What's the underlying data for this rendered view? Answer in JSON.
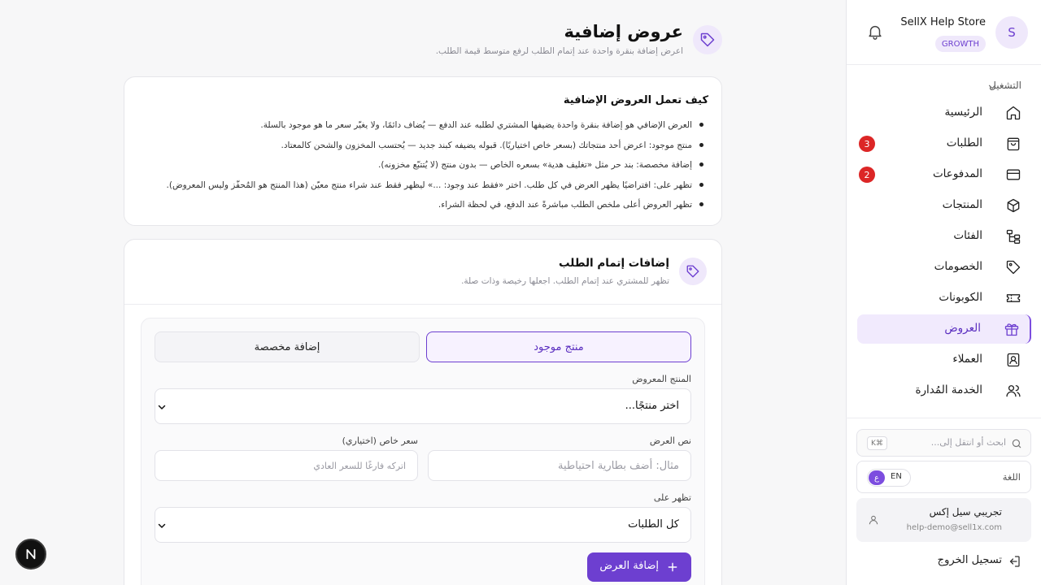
{
  "sidebar": {
    "store": {
      "avatar_letter": "S",
      "name": "SellX Help Store",
      "plan": "GROWTH"
    },
    "section_label": "التشغيل",
    "items": [
      {
        "label": "الرئيسية",
        "icon": "home-icon"
      },
      {
        "label": "الطلبات",
        "icon": "bag-icon",
        "count": "3"
      },
      {
        "label": "المدفوعات",
        "icon": "card-icon",
        "count": "2"
      },
      {
        "label": "المنتجات",
        "icon": "box-icon"
      },
      {
        "label": "الفئات",
        "icon": "category-tree-icon"
      },
      {
        "label": "الخصومات",
        "icon": "tag-icon"
      },
      {
        "label": "الكوبونات",
        "icon": "ticket-icon"
      },
      {
        "label": "العروض",
        "icon": "gift-icon",
        "active": true
      },
      {
        "label": "العملاء",
        "icon": "contact-card-icon"
      },
      {
        "label": "الخدمة المُدارة",
        "icon": "users-icon"
      }
    ],
    "search": {
      "placeholder": "ابحث أو انتقل إلى...",
      "shortcut": "K⌘"
    },
    "language": {
      "label": "اللغة",
      "en": "EN",
      "ar": "ع"
    },
    "user": {
      "name": "تجريبي سيل إكس",
      "email": "help-demo@sell1x.com"
    },
    "logout": "تسجيل الخروج"
  },
  "page": {
    "title": "عروض إضافية",
    "subtitle": "اعرض إضافة بنقرة واحدة عند إتمام الطلب لرفع متوسط قيمة الطلب."
  },
  "how_it_works": {
    "title": "كيف تعمل العروض الإضافية",
    "items": [
      "العرض الإضافي هو إضافة بنقرة واحدة يضيفها المشتري لطلبه عند الدفع — يُضاف دائمًا، ولا يغيّر سعر ما هو موجود بالسلة.",
      "منتج موجود: اعرض أحد منتجاتك (بسعر خاص اختياريًا). قبوله يضيفه كبند جديد — يُحتسب المخزون والشحن كالمعتاد.",
      "إضافة مخصصة: بند حر مثل «تغليف هدية» بسعره الخاص — بدون منتج (لا يُتتبّع مخزونه).",
      "تظهر على: افتراضيًا يظهر العرض في كل طلب. اختر «فقط عند وجود: ...» ليظهر فقط عند شراء منتج معيّن (هذا المنتج هو المُحفّز وليس المعروض).",
      "تظهر العروض أعلى ملخص الطلب مباشرةً عند الدفع، في لحظة الشراء."
    ]
  },
  "addons": {
    "title": "إضافات إتمام الطلب",
    "subtitle": "تظهر للمشتري عند إتمام الطلب. اجعلها رخيصة وذات صلة.",
    "tabs": {
      "existing": "منتج موجود",
      "custom": "إضافة مخصصة"
    },
    "product_label": "المنتج المعروض",
    "product_value": "اختر منتجًا...",
    "offer_text_label": "نص العرض",
    "offer_text_placeholder": "مثال: أضف بطارية احتياطية",
    "special_price_label": "سعر خاص (اختياري)",
    "special_price_placeholder": "اتركه فارغًا للسعر العادي",
    "shows_on_label": "تظهر على",
    "shows_on_value": "كل الطلبات",
    "add_button": "إضافة العرض"
  },
  "dev_badge": "N",
  "colors": {
    "accent": "#6d3fd0",
    "accent_soft": "#efe8fb",
    "badge_red": "#dc2626"
  }
}
